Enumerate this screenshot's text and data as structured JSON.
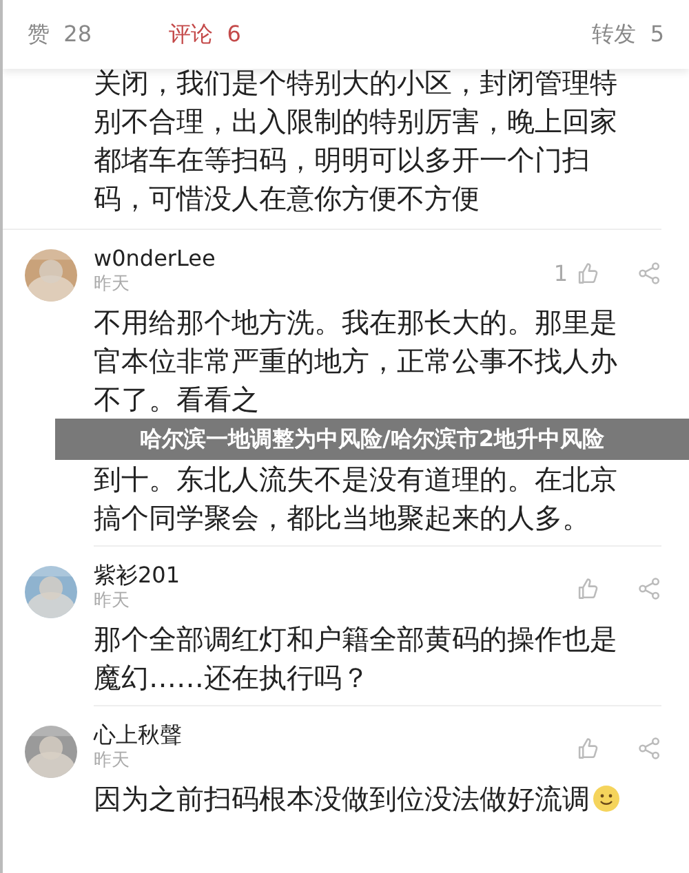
{
  "tabs": [
    {
      "label": "赞",
      "count": "28",
      "selected": false
    },
    {
      "label": "评论",
      "count": "6",
      "selected": true
    },
    {
      "label": "转发",
      "count": "5",
      "selected": false
    }
  ],
  "comments": [
    {
      "kind": "continued",
      "paragraphs": [
        "关闭，我们是个特别大的小区，封闭管理特别不合理，出入限制的特别厉害，晚上回家都堵车在等扫码，明明可以多开一个门扫码，可惜没人在意你方便不方便"
      ]
    },
    {
      "kind": "full",
      "name": "w0nderLee",
      "time": "昨天",
      "likes": "1",
      "paragraphs": [
        "不用给那个地方洗。我在那长大的。那里是官本位非常严重的地方，正常公事不找人办不了。看看之",
        "到十。东北人流失不是没有道理的。在北京搞个同学聚会，都比当地聚起来的人多。"
      ],
      "banner": "哈尔滨一地调整为中风险/哈尔滨市2地升中风险"
    },
    {
      "kind": "full",
      "name": "紫衫201",
      "time": "昨天",
      "paragraphs": [
        "那个全部调红灯和户籍全部黄码的操作也是魔幻……还在执行吗？"
      ]
    },
    {
      "kind": "full",
      "name": "心上秋聲",
      "time": "昨天",
      "paragraphs": [
        "因为之前扫码根本没做到位没法做好流调"
      ],
      "emoji": true
    }
  ]
}
